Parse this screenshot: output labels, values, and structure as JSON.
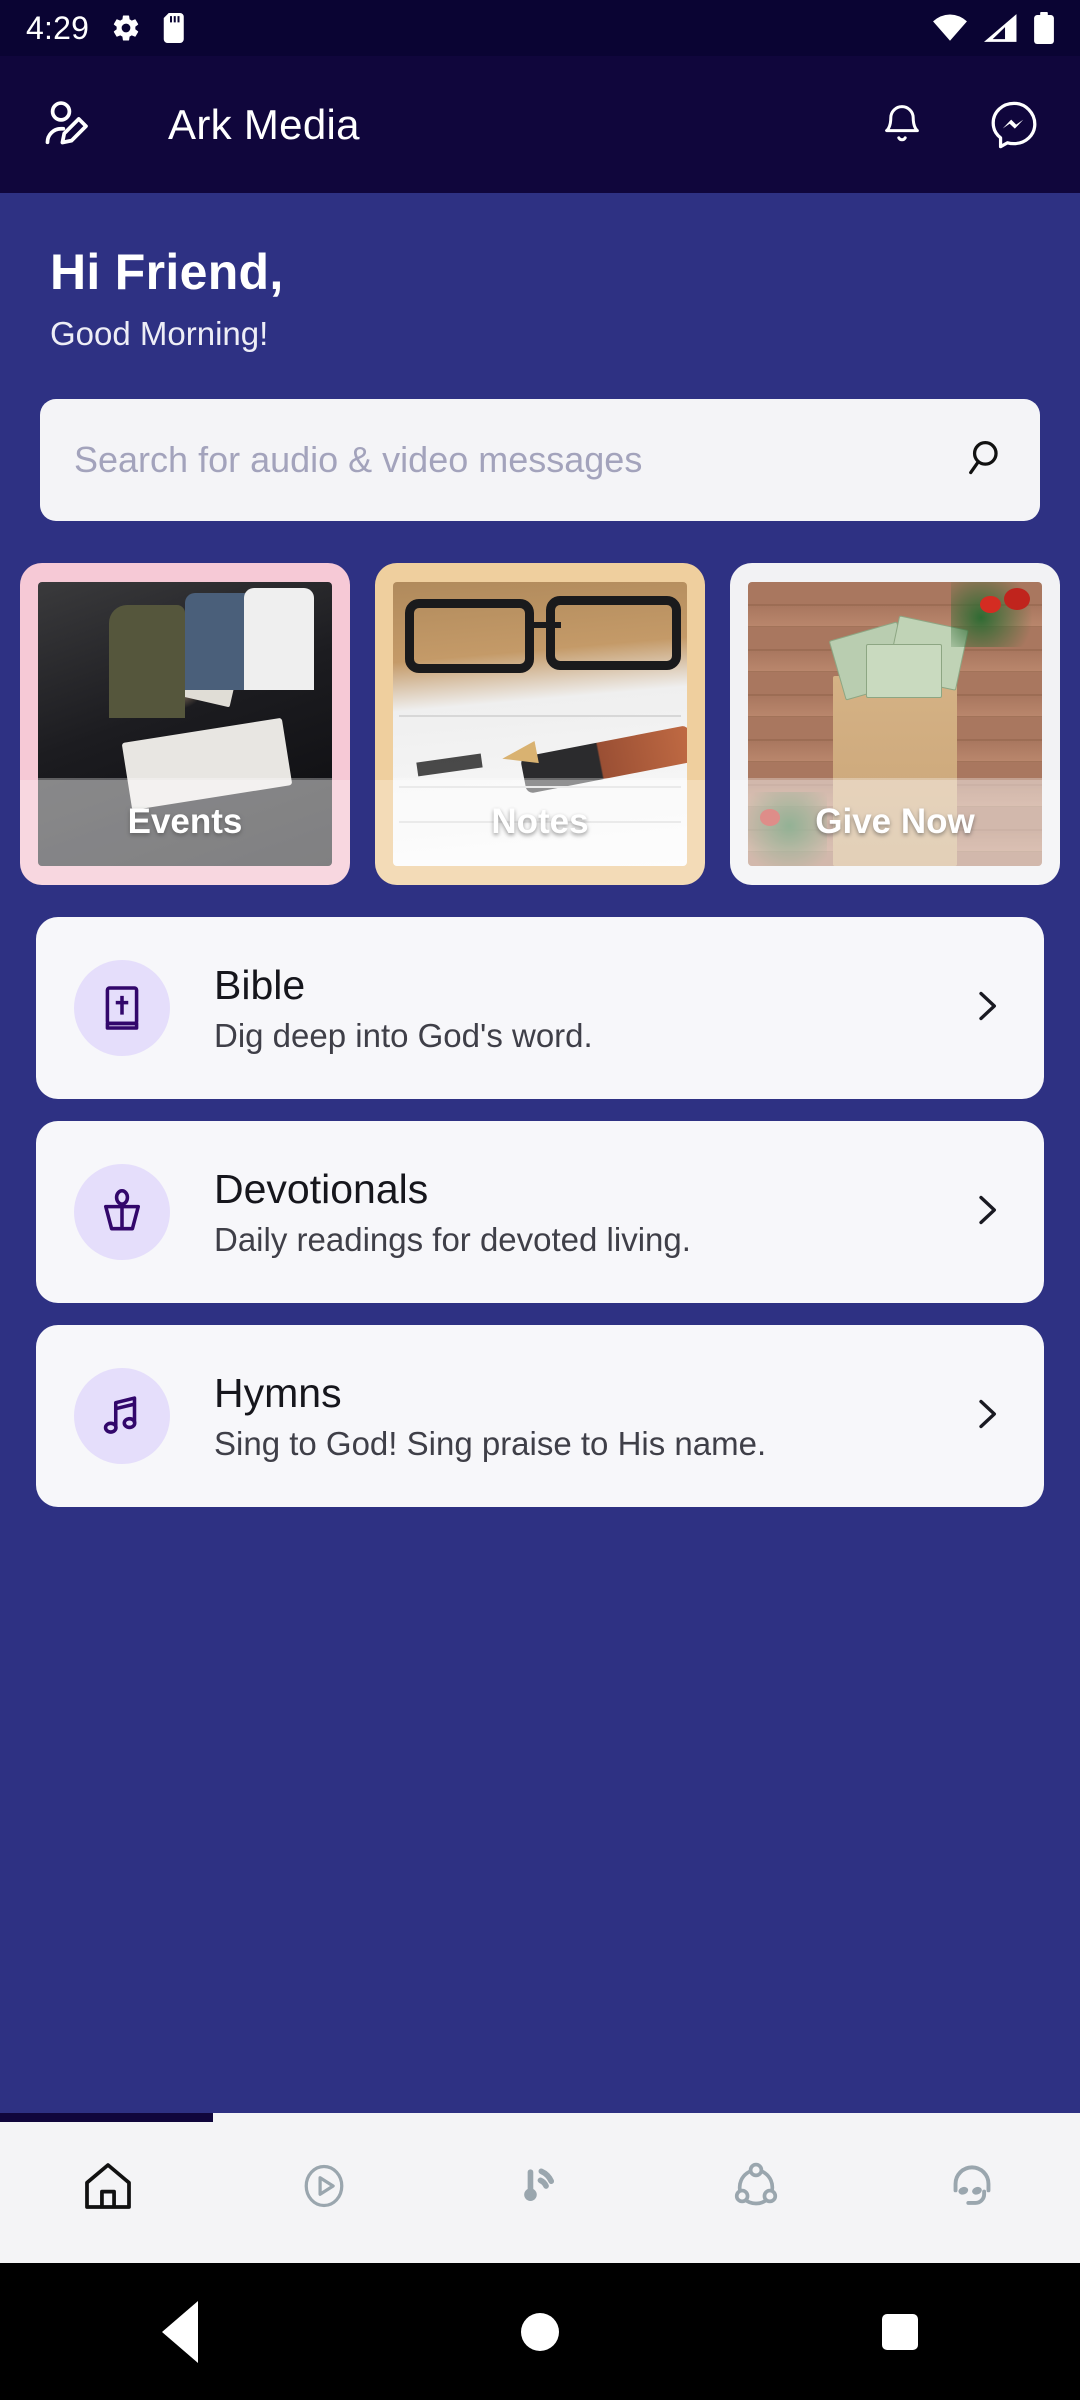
{
  "statusbar": {
    "time": "4:29",
    "icons": [
      "gear-icon",
      "sd-card-icon",
      "wifi-icon",
      "signal-icon",
      "battery-icon"
    ]
  },
  "appbar": {
    "title": "Ark Media",
    "profile_icon": "user-edit-icon",
    "notification_icon": "bell-icon",
    "messenger_icon": "messenger-icon"
  },
  "greeting": {
    "name": "Hi Friend,",
    "time_of_day": "Good Morning!"
  },
  "search": {
    "placeholder": "Search for audio & video messages",
    "value": "",
    "icon": "search-icon"
  },
  "cards": [
    {
      "label": "Events",
      "frame_color": "#F6C9D6",
      "image": "people-seated-with-books"
    },
    {
      "label": "Notes",
      "frame_color": "#EFCF9E",
      "image": "glasses-and-fountain-pen-on-notebook"
    },
    {
      "label": "Give Now",
      "frame_color": "#F2F2F4",
      "image": "cash-in-paper-bag-on-wood"
    }
  ],
  "list": [
    {
      "title": "Bible",
      "subtitle": "Dig deep into God's word.",
      "icon": "bible-icon",
      "chevron": "chevron-right-icon"
    },
    {
      "title": "Devotionals",
      "subtitle": "Daily readings for devoted living.",
      "icon": "lectern-icon",
      "chevron": "chevron-right-icon"
    },
    {
      "title": "Hymns",
      "subtitle": "Sing to God! Sing praise to His name.",
      "icon": "music-note-icon",
      "chevron": "chevron-right-icon"
    }
  ],
  "bottomnav": {
    "items": [
      {
        "icon": "home-icon",
        "active": true
      },
      {
        "icon": "play-circle-icon",
        "active": false
      },
      {
        "icon": "broadcast-icon",
        "active": false
      },
      {
        "icon": "share-network-icon",
        "active": false
      },
      {
        "icon": "headset-icon",
        "active": false
      }
    ]
  },
  "androidnav": {
    "back": "back-icon",
    "home": "home-circle-icon",
    "recents": "recents-square-icon"
  },
  "colors": {
    "status_bar": "#0A0433",
    "app_bar": "#10063C",
    "background": "#2E3183",
    "card_surface": "#F7F7FA",
    "badge": "#E5DEFB",
    "badge_icon": "#32076B"
  }
}
